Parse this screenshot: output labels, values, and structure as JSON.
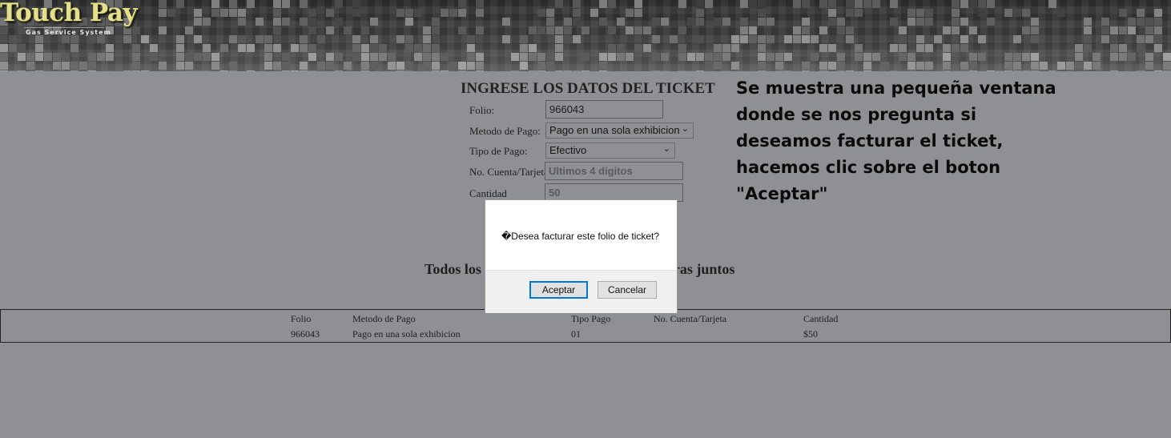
{
  "colors": {
    "page_bg": "#8f9093",
    "header_bg": "#2e2d2e",
    "logo_yellow": "#e4e08a",
    "dialog_accent": "#0078d7"
  },
  "header": {
    "logo_title": "Touch Pay",
    "logo_subtitle": "Gas Service System"
  },
  "form": {
    "title": "INGRESE LOS DATOS DEL TICKET",
    "folio": {
      "label": "Folio:",
      "value": "966043"
    },
    "metodo_pago": {
      "label": "Metodo de Pago:",
      "value": "Pago en una sola exhibicion"
    },
    "tipo_pago": {
      "label": "Tipo de Pago:",
      "value": "Efectivo"
    },
    "cuenta": {
      "label": "No. Cuenta/Tarjeta",
      "placeholder": "Ultimos 4 digitos"
    },
    "cantidad": {
      "label": "Cantidad",
      "value": "50"
    }
  },
  "section": {
    "heading_left": "Todos los",
    "heading_right": "ras juntos"
  },
  "table": {
    "headers": [
      "Folio",
      "Metodo de Pago",
      "Tipo Pago",
      "No. Cuenta/Tarjeta",
      "Cantidad"
    ],
    "row": [
      "966043",
      "Pago en una sola exhibicion",
      "01",
      "",
      "$50"
    ]
  },
  "dialog": {
    "message": "�Desea facturar este folio de ticket?",
    "ok_label": "Aceptar",
    "cancel_label": "Cancelar"
  },
  "annotation": {
    "line1": "Se muestra una pequeña ventana",
    "line2": "donde se nos pregunta si",
    "line3": "deseamos facturar el ticket,",
    "line4": "hacemos clic sobre el boton",
    "line5": "\"Aceptar\""
  }
}
